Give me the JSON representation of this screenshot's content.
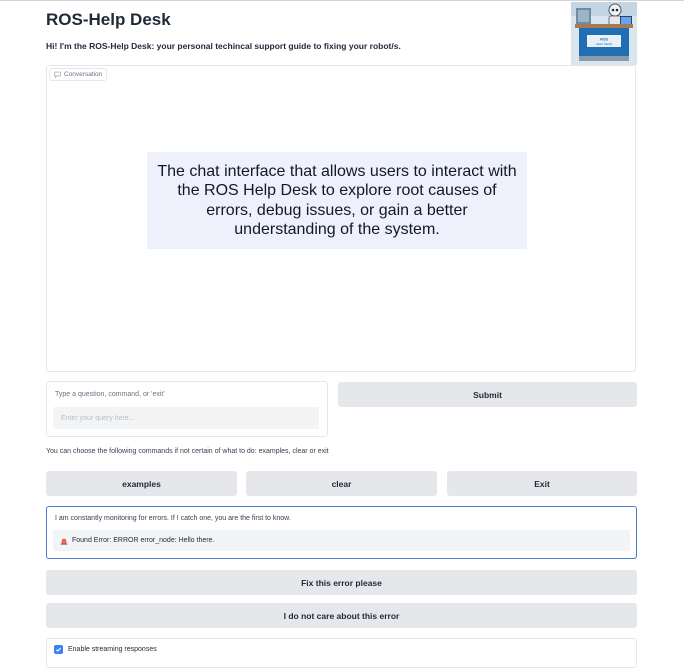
{
  "app": {
    "title": "ROS-Help Desk",
    "subtitle": "Hi! I'm the ROS-Help Desk: your personal techincal support guide to fixing your robot/s."
  },
  "logo": {
    "sign_text": "ROS HELP DESK"
  },
  "chat": {
    "label": "Conversation",
    "icon": "chat-bubble-icon",
    "note": "The chat interface that allows users to interact with the ROS Help Desk to explore root causes of errors, debug issues, or gain a better understanding of the system."
  },
  "query": {
    "label": "Type a question, command, or 'exit'",
    "placeholder": "Enter your query here...",
    "value": ""
  },
  "buttons": {
    "submit": "Submit",
    "examples": "examples",
    "clear": "clear",
    "exit": "Exit",
    "fix": "Fix this error please",
    "ignore": "I do not care about this error"
  },
  "hint": "You can choose the following commands if not certain of what to do: examples, clear or exit",
  "monitor": {
    "text": "I am constantly monitoring for errors. If I catch one, you are the first to know.",
    "error_icon": "siren-icon",
    "error": "Found Error: ERROR error_node: Hello there."
  },
  "streaming": {
    "label": "Enable streaming responses",
    "checked": true
  },
  "colors": {
    "accent": "#3b82f6",
    "button_bg": "#e5e7eb",
    "note_bg": "#eef1fb",
    "monitor_border": "#4a7fc9"
  }
}
